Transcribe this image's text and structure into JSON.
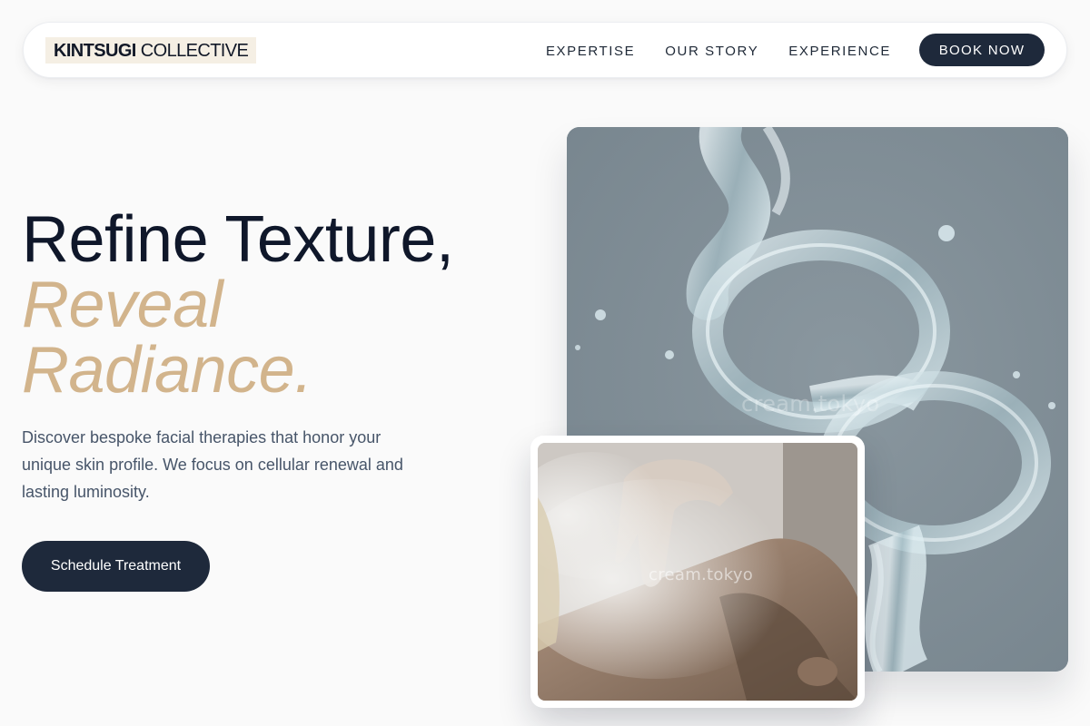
{
  "nav": {
    "logo_bold": "KINTSUGI",
    "logo_light": "COLLECTIVE",
    "links": [
      "EXPERTISE",
      "OUR STORY",
      "EXPERIENCE"
    ],
    "cta_label": "BOOK NOW"
  },
  "hero": {
    "title_line1": "Refine Texture,",
    "title_accent_line1": "Reveal",
    "title_accent_line2": "Radiance.",
    "description": "Discover bespoke facial therapies that honor your unique skin profile. We focus on cellular renewal and lasting luminosity.",
    "cta_label": "Schedule Treatment"
  },
  "images": {
    "water_watermark": "cream.tokyo",
    "mist_watermark": "cream.tokyo"
  },
  "colors": {
    "accent": "#d2b48c",
    "dark": "#1e293b",
    "background": "#fafafa"
  }
}
